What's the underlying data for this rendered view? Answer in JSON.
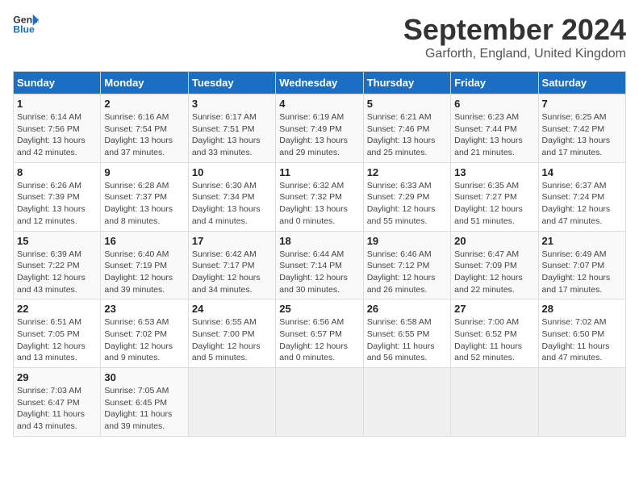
{
  "header": {
    "logo_line1": "General",
    "logo_line2": "Blue",
    "month": "September 2024",
    "location": "Garforth, England, United Kingdom"
  },
  "days_of_week": [
    "Sunday",
    "Monday",
    "Tuesday",
    "Wednesday",
    "Thursday",
    "Friday",
    "Saturday"
  ],
  "weeks": [
    [
      {
        "day": "1",
        "lines": [
          "Sunrise: 6:14 AM",
          "Sunset: 7:56 PM",
          "Daylight: 13 hours",
          "and 42 minutes."
        ]
      },
      {
        "day": "2",
        "lines": [
          "Sunrise: 6:16 AM",
          "Sunset: 7:54 PM",
          "Daylight: 13 hours",
          "and 37 minutes."
        ]
      },
      {
        "day": "3",
        "lines": [
          "Sunrise: 6:17 AM",
          "Sunset: 7:51 PM",
          "Daylight: 13 hours",
          "and 33 minutes."
        ]
      },
      {
        "day": "4",
        "lines": [
          "Sunrise: 6:19 AM",
          "Sunset: 7:49 PM",
          "Daylight: 13 hours",
          "and 29 minutes."
        ]
      },
      {
        "day": "5",
        "lines": [
          "Sunrise: 6:21 AM",
          "Sunset: 7:46 PM",
          "Daylight: 13 hours",
          "and 25 minutes."
        ]
      },
      {
        "day": "6",
        "lines": [
          "Sunrise: 6:23 AM",
          "Sunset: 7:44 PM",
          "Daylight: 13 hours",
          "and 21 minutes."
        ]
      },
      {
        "day": "7",
        "lines": [
          "Sunrise: 6:25 AM",
          "Sunset: 7:42 PM",
          "Daylight: 13 hours",
          "and 17 minutes."
        ]
      }
    ],
    [
      {
        "day": "8",
        "lines": [
          "Sunrise: 6:26 AM",
          "Sunset: 7:39 PM",
          "Daylight: 13 hours",
          "and 12 minutes."
        ]
      },
      {
        "day": "9",
        "lines": [
          "Sunrise: 6:28 AM",
          "Sunset: 7:37 PM",
          "Daylight: 13 hours",
          "and 8 minutes."
        ]
      },
      {
        "day": "10",
        "lines": [
          "Sunrise: 6:30 AM",
          "Sunset: 7:34 PM",
          "Daylight: 13 hours",
          "and 4 minutes."
        ]
      },
      {
        "day": "11",
        "lines": [
          "Sunrise: 6:32 AM",
          "Sunset: 7:32 PM",
          "Daylight: 13 hours",
          "and 0 minutes."
        ]
      },
      {
        "day": "12",
        "lines": [
          "Sunrise: 6:33 AM",
          "Sunset: 7:29 PM",
          "Daylight: 12 hours",
          "and 55 minutes."
        ]
      },
      {
        "day": "13",
        "lines": [
          "Sunrise: 6:35 AM",
          "Sunset: 7:27 PM",
          "Daylight: 12 hours",
          "and 51 minutes."
        ]
      },
      {
        "day": "14",
        "lines": [
          "Sunrise: 6:37 AM",
          "Sunset: 7:24 PM",
          "Daylight: 12 hours",
          "and 47 minutes."
        ]
      }
    ],
    [
      {
        "day": "15",
        "lines": [
          "Sunrise: 6:39 AM",
          "Sunset: 7:22 PM",
          "Daylight: 12 hours",
          "and 43 minutes."
        ]
      },
      {
        "day": "16",
        "lines": [
          "Sunrise: 6:40 AM",
          "Sunset: 7:19 PM",
          "Daylight: 12 hours",
          "and 39 minutes."
        ]
      },
      {
        "day": "17",
        "lines": [
          "Sunrise: 6:42 AM",
          "Sunset: 7:17 PM",
          "Daylight: 12 hours",
          "and 34 minutes."
        ]
      },
      {
        "day": "18",
        "lines": [
          "Sunrise: 6:44 AM",
          "Sunset: 7:14 PM",
          "Daylight: 12 hours",
          "and 30 minutes."
        ]
      },
      {
        "day": "19",
        "lines": [
          "Sunrise: 6:46 AM",
          "Sunset: 7:12 PM",
          "Daylight: 12 hours",
          "and 26 minutes."
        ]
      },
      {
        "day": "20",
        "lines": [
          "Sunrise: 6:47 AM",
          "Sunset: 7:09 PM",
          "Daylight: 12 hours",
          "and 22 minutes."
        ]
      },
      {
        "day": "21",
        "lines": [
          "Sunrise: 6:49 AM",
          "Sunset: 7:07 PM",
          "Daylight: 12 hours",
          "and 17 minutes."
        ]
      }
    ],
    [
      {
        "day": "22",
        "lines": [
          "Sunrise: 6:51 AM",
          "Sunset: 7:05 PM",
          "Daylight: 12 hours",
          "and 13 minutes."
        ]
      },
      {
        "day": "23",
        "lines": [
          "Sunrise: 6:53 AM",
          "Sunset: 7:02 PM",
          "Daylight: 12 hours",
          "and 9 minutes."
        ]
      },
      {
        "day": "24",
        "lines": [
          "Sunrise: 6:55 AM",
          "Sunset: 7:00 PM",
          "Daylight: 12 hours",
          "and 5 minutes."
        ]
      },
      {
        "day": "25",
        "lines": [
          "Sunrise: 6:56 AM",
          "Sunset: 6:57 PM",
          "Daylight: 12 hours",
          "and 0 minutes."
        ]
      },
      {
        "day": "26",
        "lines": [
          "Sunrise: 6:58 AM",
          "Sunset: 6:55 PM",
          "Daylight: 11 hours",
          "and 56 minutes."
        ]
      },
      {
        "day": "27",
        "lines": [
          "Sunrise: 7:00 AM",
          "Sunset: 6:52 PM",
          "Daylight: 11 hours",
          "and 52 minutes."
        ]
      },
      {
        "day": "28",
        "lines": [
          "Sunrise: 7:02 AM",
          "Sunset: 6:50 PM",
          "Daylight: 11 hours",
          "and 47 minutes."
        ]
      }
    ],
    [
      {
        "day": "29",
        "lines": [
          "Sunrise: 7:03 AM",
          "Sunset: 6:47 PM",
          "Daylight: 11 hours",
          "and 43 minutes."
        ]
      },
      {
        "day": "30",
        "lines": [
          "Sunrise: 7:05 AM",
          "Sunset: 6:45 PM",
          "Daylight: 11 hours",
          "and 39 minutes."
        ]
      },
      null,
      null,
      null,
      null,
      null
    ]
  ]
}
